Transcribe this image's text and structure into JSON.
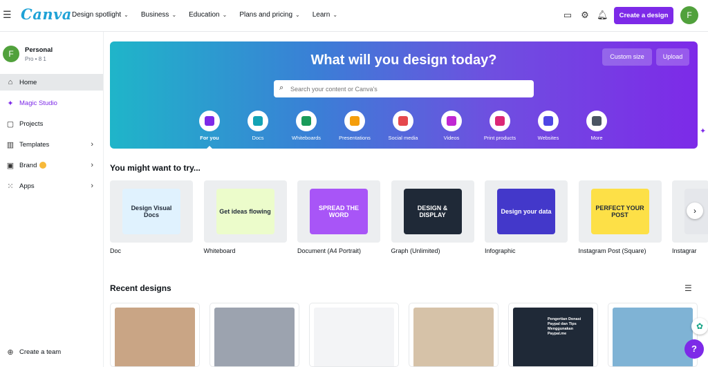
{
  "topbar": {
    "menu_icon": "hamburger-icon",
    "logo": "Canva",
    "nav": [
      "Design spotlight",
      "Business",
      "Education",
      "Plans and pricing",
      "Learn"
    ],
    "create_button": "Create a design",
    "avatar_initial": "F",
    "icons": [
      "desktop-icon",
      "gear-icon",
      "bell-icon"
    ]
  },
  "sidebar": {
    "account_name": "Personal",
    "account_sub": "Pro • 8 1",
    "avatar_initial": "F",
    "items": [
      {
        "label": "Home",
        "icon": "home-icon"
      },
      {
        "label": "Magic Studio",
        "icon": "sparkle-icon"
      },
      {
        "label": "Projects",
        "icon": "folder-icon"
      },
      {
        "label": "Templates",
        "icon": "templates-icon"
      },
      {
        "label": "Brand",
        "icon": "brand-icon"
      },
      {
        "label": "Apps",
        "icon": "apps-icon"
      }
    ],
    "create_team": "Create a team"
  },
  "hero": {
    "title": "What will you design today?",
    "custom_size": "Custom size",
    "upload": "Upload",
    "search_placeholder": "Search your content or Canva's",
    "categories": [
      {
        "label": "For you",
        "color": "#7d2ae8"
      },
      {
        "label": "Docs",
        "color": "#13a3b5"
      },
      {
        "label": "Whiteboards",
        "color": "#1a9b5a"
      },
      {
        "label": "Presentations",
        "color": "#f59e0b"
      },
      {
        "label": "Social media",
        "color": "#e5484d"
      },
      {
        "label": "Videos",
        "color": "#c026d3"
      },
      {
        "label": "Print products",
        "color": "#db2777"
      },
      {
        "label": "Websites",
        "color": "#4f46e5"
      },
      {
        "label": "More",
        "color": "#4b5563"
      }
    ]
  },
  "try_section": {
    "title": "You might want to try...",
    "cards": [
      {
        "label": "Doc",
        "text": "Design Visual Docs",
        "color": "#e0f2fe"
      },
      {
        "label": "Whiteboard",
        "text": "Get ideas flowing",
        "color": "#ecfccb"
      },
      {
        "label": "Document (A4 Portrait)",
        "text": "SPREAD THE WORD",
        "color": "#a855f7"
      },
      {
        "label": "Graph (Unlimited)",
        "text": "DESIGN & DISPLAY",
        "color": "#1f2937"
      },
      {
        "label": "Infographic",
        "text": "Design your data",
        "color": "#4338ca"
      },
      {
        "label": "Instagram Post (Square)",
        "text": "PERFECT YOUR POST",
        "color": "#fde047"
      },
      {
        "label": "Instagrar",
        "text": "",
        "color": "#e5e7eb"
      }
    ]
  },
  "recent": {
    "title": "Recent designs",
    "cards": [
      {
        "color": "#c9a585"
      },
      {
        "color": "#9ca3af"
      },
      {
        "color": "#f3f4f6"
      },
      {
        "color": "#d6c2a8"
      },
      {
        "color": "#1f2937",
        "text": "Pengertian Donasi Paypal dan Tips Menggunakan Paypal.me"
      },
      {
        "color": "#7fb3d5"
      }
    ]
  }
}
